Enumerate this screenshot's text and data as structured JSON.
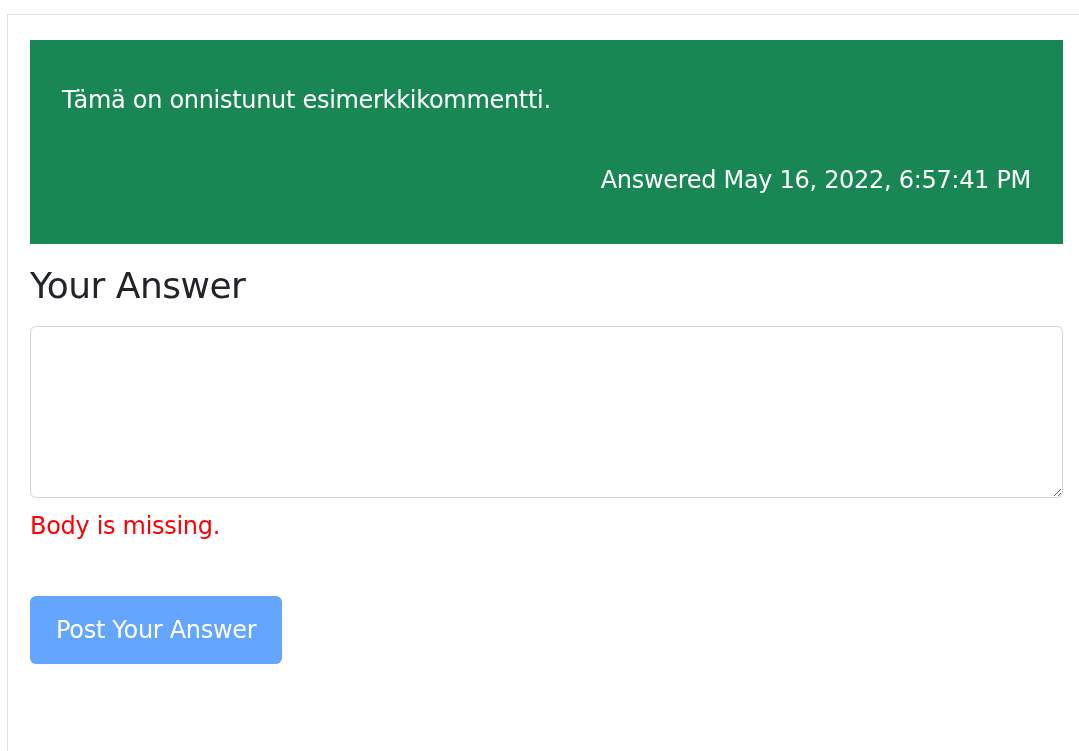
{
  "comment": {
    "text": "Tämä on onnistunut esimerkkikommentti.",
    "timestamp": "Answered May 16, 2022, 6:57:41 PM"
  },
  "answer_form": {
    "heading": "Your Answer",
    "error": "Body is missing.",
    "submit": {
      "label": "Post Your Answer",
      "disabled": true
    }
  }
}
